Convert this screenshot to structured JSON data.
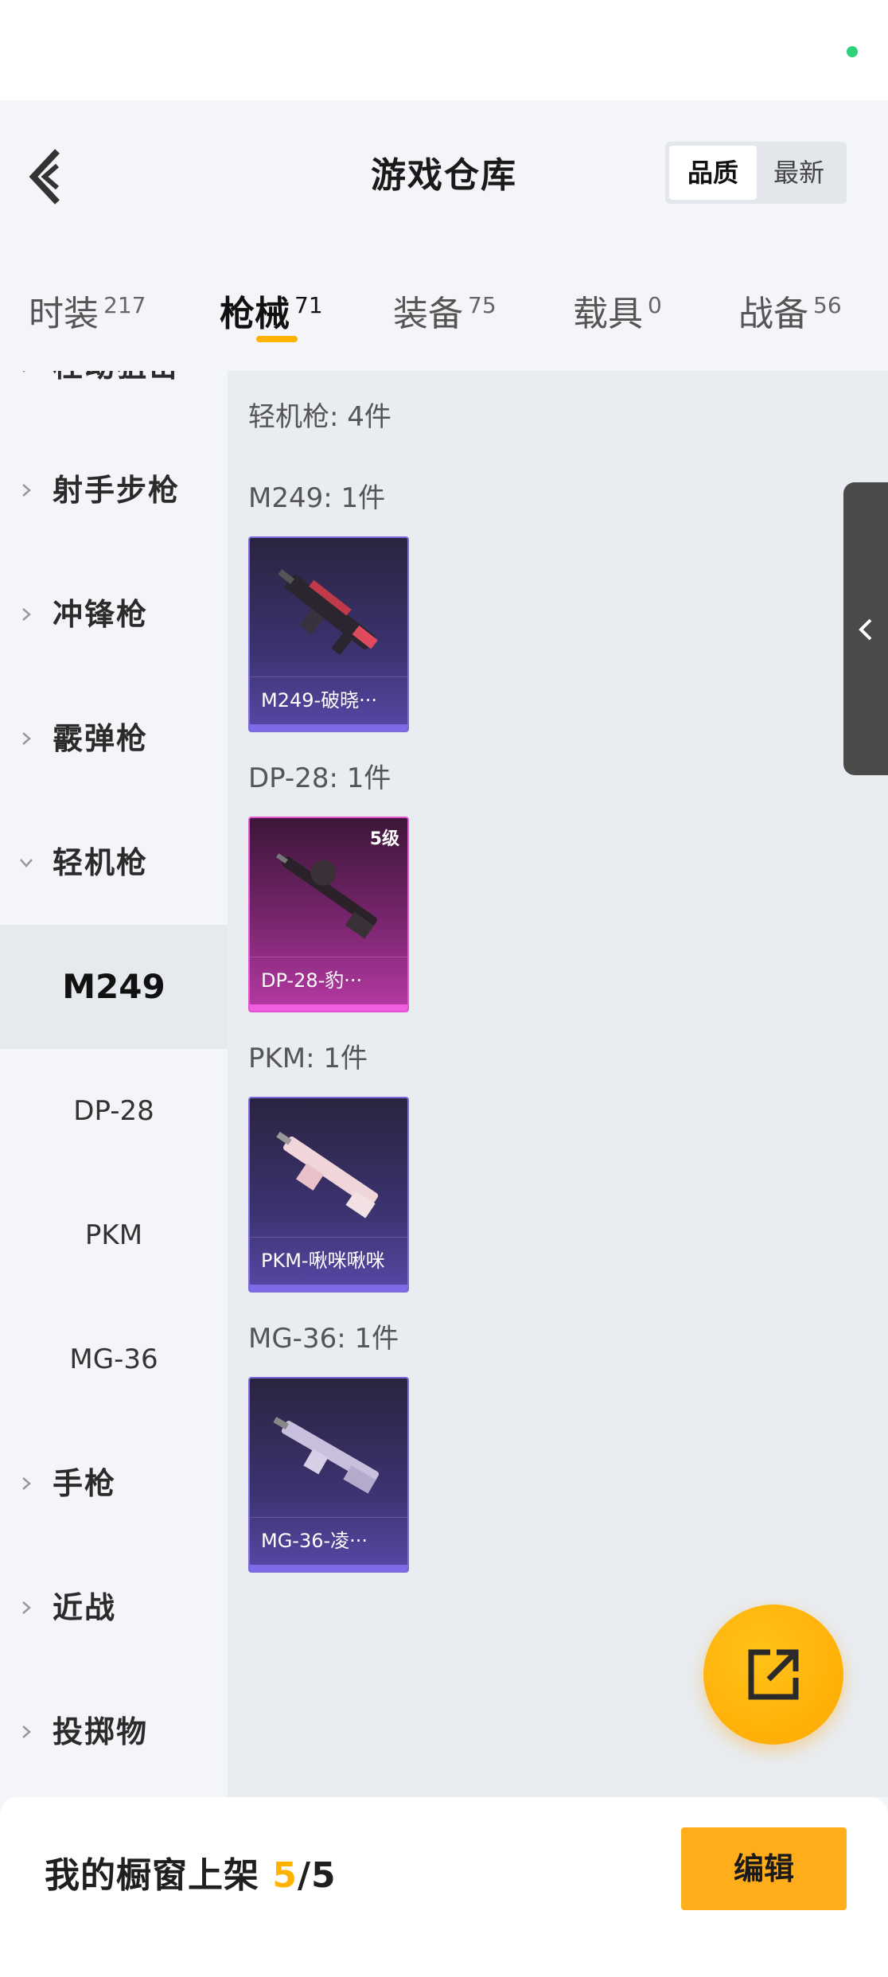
{
  "header": {
    "title": "游戏仓库",
    "sort_options": [
      "品质",
      "最新"
    ],
    "sort_active": "品质"
  },
  "tabs": [
    {
      "label": "时装",
      "count": "217"
    },
    {
      "label": "枪械",
      "count": "71",
      "active": true
    },
    {
      "label": "装备",
      "count": "75"
    },
    {
      "label": "载具",
      "count": "0"
    },
    {
      "label": "战备",
      "count": "56"
    }
  ],
  "sidebar": {
    "partial_top": "栓动狙击",
    "categories": [
      {
        "label": "射手步枪",
        "expanded": false
      },
      {
        "label": "冲锋枪",
        "expanded": false
      },
      {
        "label": "霰弹枪",
        "expanded": false
      },
      {
        "label": "轻机枪",
        "expanded": true
      }
    ],
    "subitems": [
      {
        "label": "M249",
        "active": true
      },
      {
        "label": "DP-28"
      },
      {
        "label": "PKM"
      },
      {
        "label": "MG-36"
      }
    ],
    "after": [
      {
        "label": "手枪"
      },
      {
        "label": "近战"
      },
      {
        "label": "投掷物"
      }
    ]
  },
  "content": {
    "category_summary": "轻机枪: 4件",
    "sections": [
      {
        "title": "M249: 1件",
        "item_name": "M249-破晓···",
        "rarity": "purple",
        "level": ""
      },
      {
        "title": "DP-28: 1件",
        "item_name": "DP-28-豹···",
        "rarity": "pink",
        "level": "5级"
      },
      {
        "title": "PKM: 1件",
        "item_name": "PKM-啾咪啾咪",
        "rarity": "purple",
        "level": ""
      },
      {
        "title": "MG-36: 1件",
        "item_name": "MG-36-凌···",
        "rarity": "purple",
        "level": ""
      }
    ]
  },
  "bottom": {
    "showcase_label": "我的橱窗上架 ",
    "showcase_used": "5",
    "showcase_total": "/5",
    "edit_label": "编辑"
  },
  "colors": {
    "accent": "#ffb300",
    "status_dot": "#2fd07a",
    "purple_rarity": "#7c6ad9",
    "pink_rarity": "#e055cf"
  },
  "icons": [
    "back-arrow-icon",
    "chevron-right-icon",
    "chevron-down-icon",
    "collapse-handle-chevron-icon",
    "share-external-icon"
  ]
}
